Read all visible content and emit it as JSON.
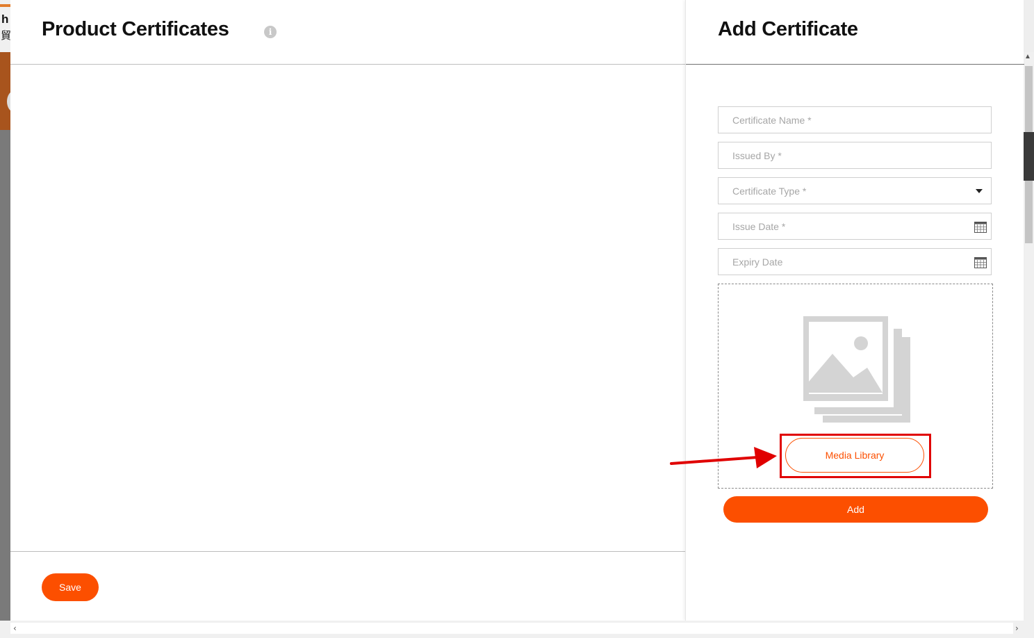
{
  "left_panel": {
    "title": "Product Certificates",
    "info_icon": "i",
    "save_label": "Save"
  },
  "right_panel": {
    "title": "Add Certificate",
    "fields": {
      "certificate_name": "Certificate Name *",
      "issued_by": "Issued By *",
      "certificate_type": "Certificate Type *",
      "issue_date": "Issue Date *",
      "expiry_date": "Expiry Date"
    },
    "media_library_label": "Media Library",
    "add_label": "Add"
  },
  "background": {
    "header_text_1": "h",
    "header_text_2": "貿"
  },
  "scrollbar": {
    "left_arrow": "‹",
    "right_arrow": "›"
  },
  "colors": {
    "accent": "#fc4f00",
    "highlight": "#e00000"
  },
  "icons": [
    "info-icon",
    "caret-down-icon",
    "calendar-icon",
    "image-gallery-icon",
    "arrow-annotation-icon"
  ]
}
